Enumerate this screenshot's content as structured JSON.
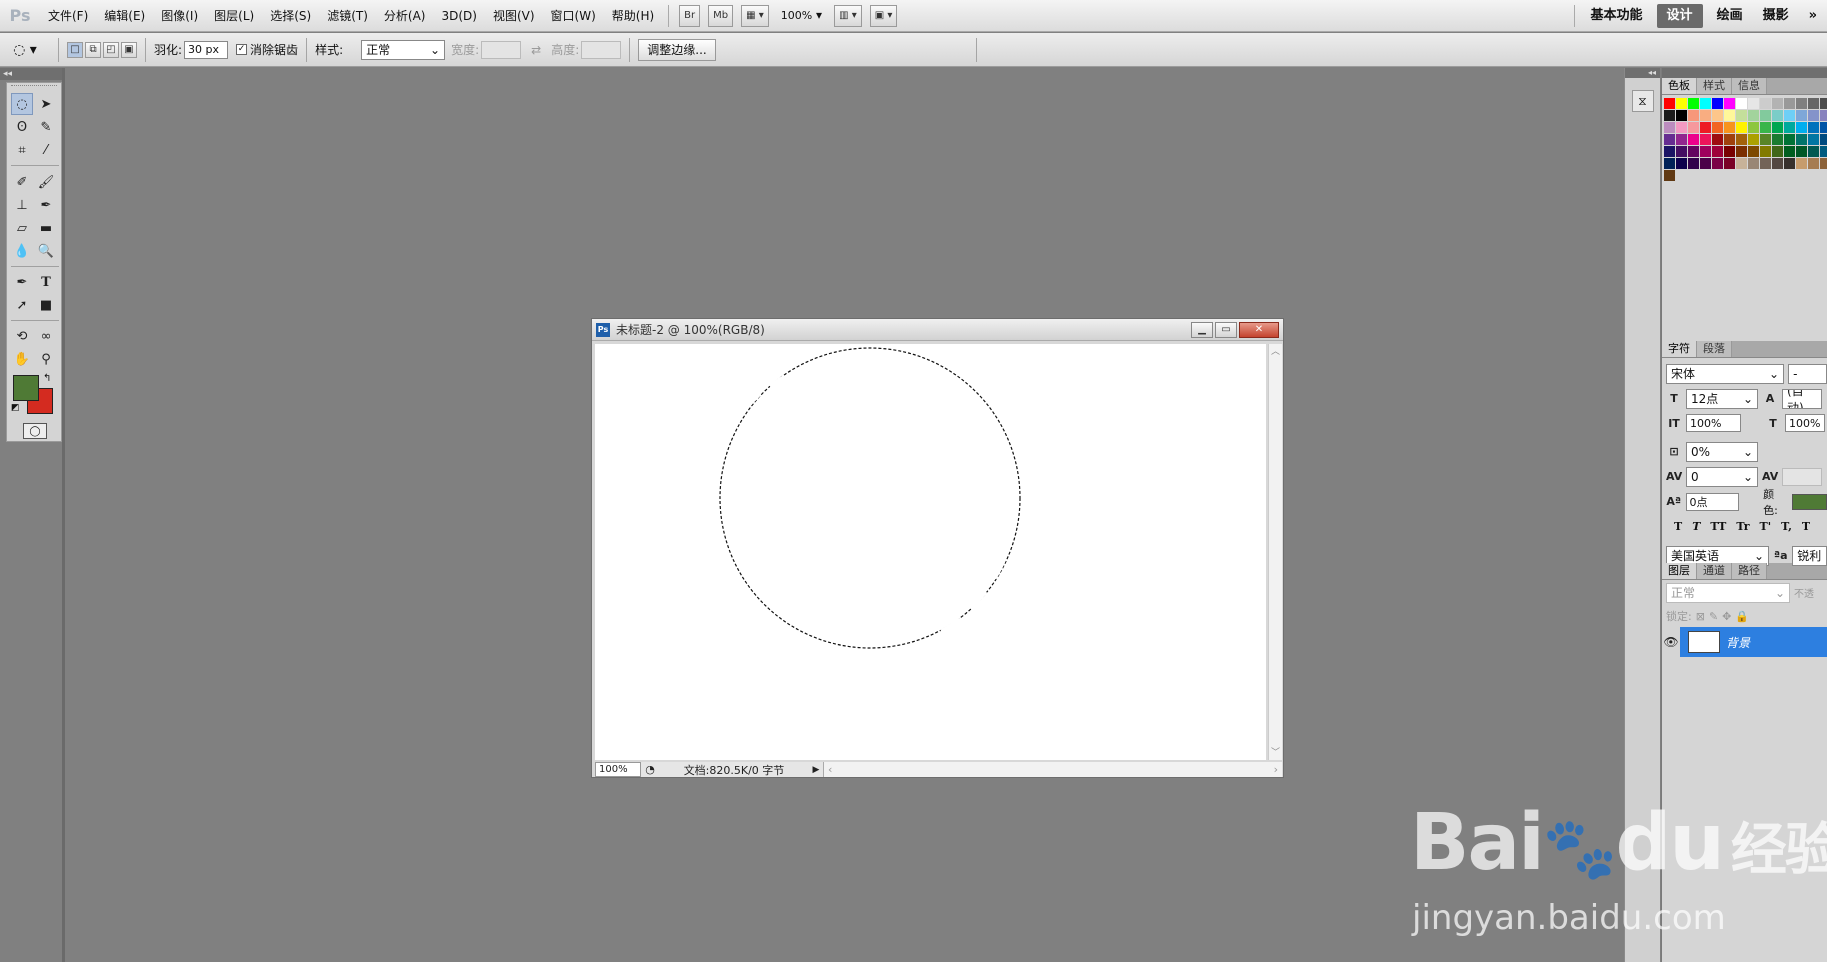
{
  "app": {
    "logo": "Ps"
  },
  "menu": [
    "文件(F)",
    "编辑(E)",
    "图像(I)",
    "图层(L)",
    "选择(S)",
    "滤镜(T)",
    "分析(A)",
    "3D(D)",
    "视图(V)",
    "窗口(W)",
    "帮助(H)"
  ],
  "appbar": {
    "bridge": "Br",
    "minibridge": "Mb",
    "zoom": "100%"
  },
  "workspaces": {
    "essentials": "基本功能",
    "design": "设计",
    "painting": "绘画",
    "photography": "摄影",
    "more": "»"
  },
  "options": {
    "feather_label": "羽化:",
    "feather_value": "30 px",
    "antialias_label": "消除锯齿",
    "style_label": "样式:",
    "style_value": "正常",
    "width_label": "宽度:",
    "height_label": "高度:",
    "refine_edge": "调整边缘..."
  },
  "document": {
    "title": "未标题-2 @ 100%(RGB/8)",
    "zoom": "100%",
    "doc_info": "文档:820.5K/0 字节"
  },
  "colors": {
    "foreground": "#4f7a35",
    "background": "#d42b20",
    "accent": "#2d7fe0"
  },
  "panel_swatches": {
    "tabs": [
      "色板",
      "样式",
      "信息"
    ],
    "colors": [
      "#ff0000",
      "#ffff00",
      "#00ff00",
      "#00ffff",
      "#0000ff",
      "#ff00ff",
      "#ffffff",
      "#e6e6e6",
      "#cccccc",
      "#b3b3b3",
      "#999999",
      "#808080",
      "#666666",
      "#4d4d4d",
      "#333333",
      "#1a1a1a",
      "#000000",
      "#f7977a",
      "#f9ad81",
      "#fdc68a",
      "#fff79a",
      "#c4df9b",
      "#a2d39c",
      "#82ca9d",
      "#7bcdc8",
      "#6ecff6",
      "#7ea7d8",
      "#8493ca",
      "#8882be",
      "#a187be",
      "#bc8dbf",
      "#f49ac2",
      "#f6989d",
      "#ed1c24",
      "#f26522",
      "#f7941d",
      "#fff200",
      "#8dc63f",
      "#39b54a",
      "#00a651",
      "#00a99d",
      "#00aeef",
      "#0072bc",
      "#0054a6",
      "#2e3192",
      "#662d91",
      "#92278f",
      "#ec008c",
      "#ed145b",
      "#9e0b0f",
      "#a0410d",
      "#a3620a",
      "#aba000",
      "#598527",
      "#1a7b30",
      "#007236",
      "#00746b",
      "#0076a3",
      "#004b80",
      "#003471",
      "#1b1464",
      "#440e62",
      "#630460",
      "#9e005d",
      "#9e0039",
      "#790000",
      "#7b2e00",
      "#7d4900",
      "#827b00",
      "#406618",
      "#005e20",
      "#005826",
      "#005952",
      "#005b7f",
      "#003663",
      "#002157",
      "#0d004c",
      "#32004b",
      "#4b0049",
      "#7b0046",
      "#7a0026",
      "#c7b299",
      "#998675",
      "#736357",
      "#534741",
      "#37302d",
      "#c69c6d",
      "#a67c52",
      "#8c6239",
      "#754c24",
      "#603913"
    ]
  },
  "panel_character": {
    "tabs": [
      "字符",
      "段落"
    ],
    "font": "宋体",
    "style": "-",
    "size": "12点",
    "leading": "(自动)",
    "vscale": "100%",
    "hscale": "100%",
    "tracking_pct": "0%",
    "kerning": "0",
    "baseline": "0点",
    "color_label": "颜色:",
    "styles": [
      "T",
      "T",
      "TT",
      "Tr",
      "T'",
      "T,",
      "T"
    ],
    "language": "美国英语",
    "aa": "锐利"
  },
  "panel_layers": {
    "tabs": [
      "图层",
      "通道",
      "路径"
    ],
    "blend": "正常",
    "opacity_label": "不透",
    "lock_label": "锁定:",
    "layer_name": "背景"
  },
  "watermark": {
    "brand": "Bai",
    "brand2": "du",
    "cn": "经验",
    "url": "jingyan.baidu.com"
  }
}
